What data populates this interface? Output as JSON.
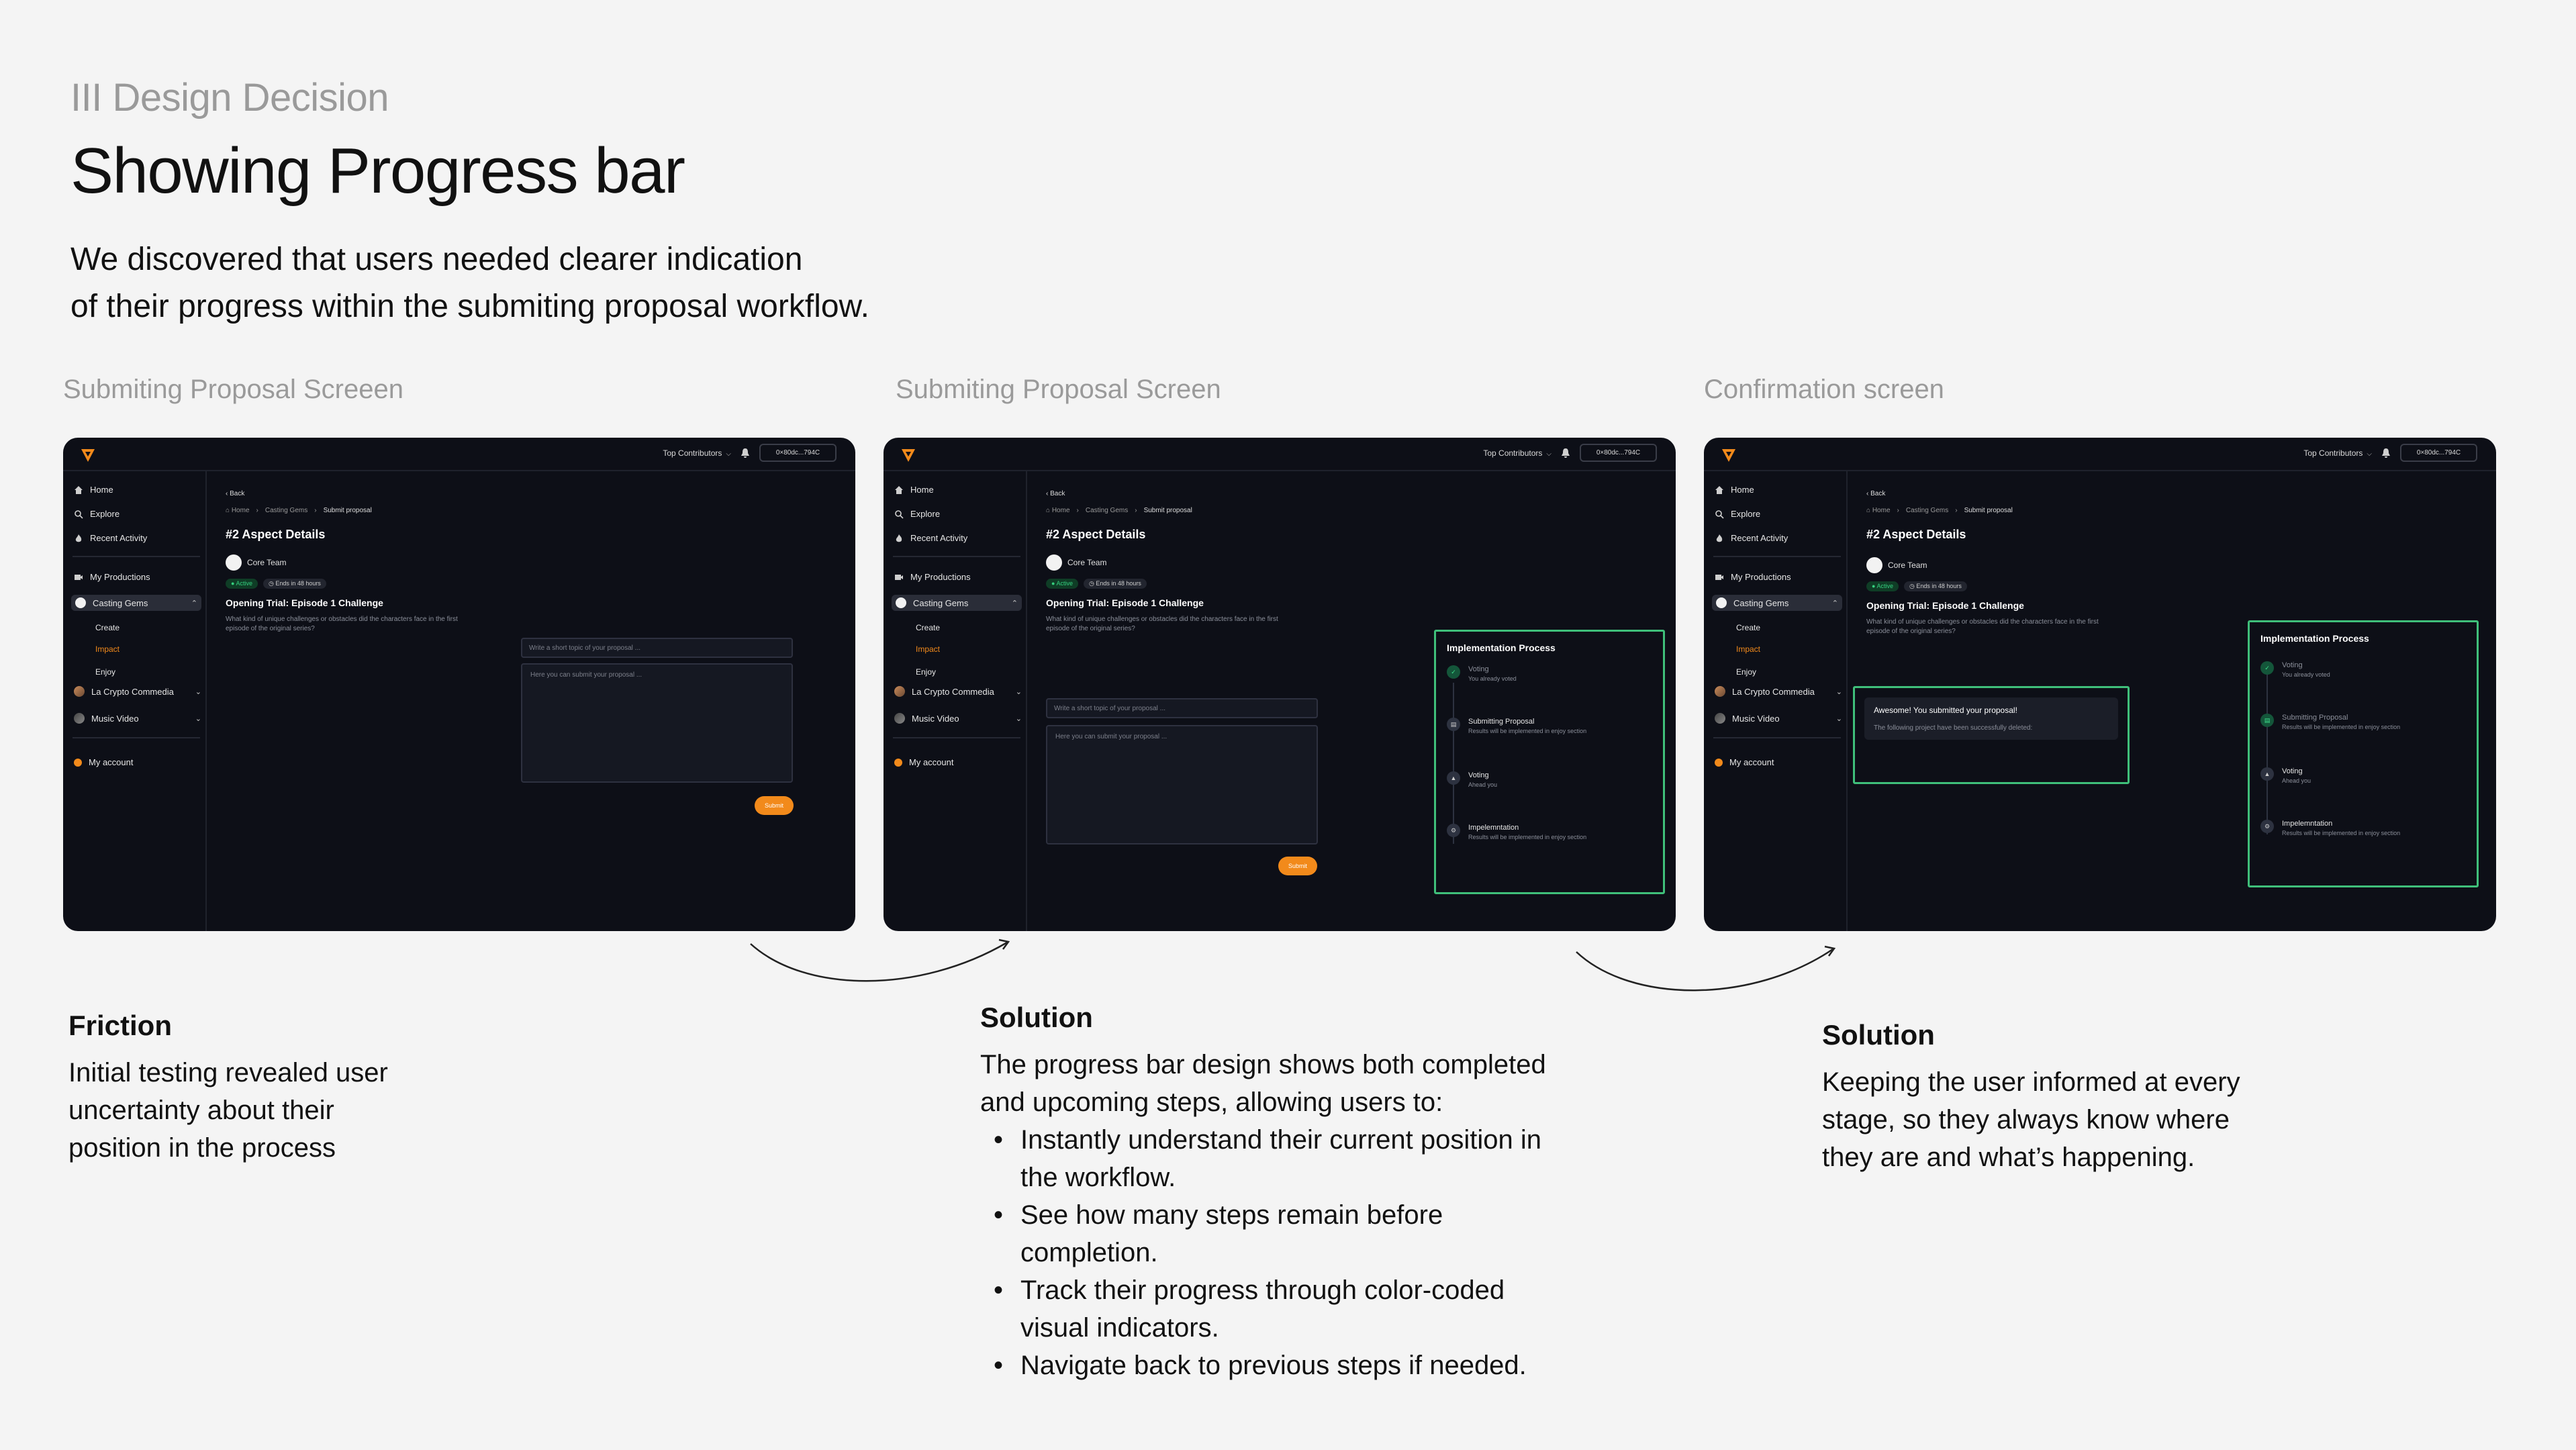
{
  "header": {
    "kicker": "III Design Decision",
    "title": "Showing Progress bar",
    "intro_line1": "We discovered that users needed clearer indication",
    "intro_line2": "of their progress within the submiting proposal workflow."
  },
  "screens": [
    {
      "label": "Submiting Proposal Screeen"
    },
    {
      "label": "Submiting Proposal Screen"
    },
    {
      "label": "Confirmation screen"
    }
  ],
  "app": {
    "top_contributors": "Top Contributors",
    "wallet": "0×80dc...794C",
    "nav": {
      "home": "Home",
      "explore": "Explore",
      "recent_activity": "Recent Activity",
      "my_productions": "My Productions",
      "casting_gems": "Casting Gems",
      "create": "Create",
      "impact": "Impact",
      "enjoy": "Enjoy",
      "la_crypto": "La Crypto Commedia",
      "music_video": "Music Video",
      "my_account": "My account"
    },
    "back": "Back",
    "breadcrumb": [
      "Home",
      "Casting Gems",
      "Submit proposal"
    ],
    "section_title": "#2 Aspect Details",
    "team": "Core Team",
    "badge_active": "Active",
    "badge_ends": "Ends in 48 hours",
    "challenge": "Opening Trial: Episode 1 Challenge",
    "question": "What kind of unique challenges or obstacles did the characters face in the first episode of the original series?",
    "topic_placeholder": "Write a short topic of your proposal ...",
    "body_placeholder": "Here you can submit your proposal ...",
    "submit": "Submit",
    "impl_title": "Implementation Process",
    "steps": [
      {
        "title": "Voting",
        "sub": "You already voted"
      },
      {
        "title": "Submitting Proposal",
        "sub": "Results will be implemented in enjoy section"
      },
      {
        "title": "Voting",
        "sub": "Ahead you"
      },
      {
        "title": "Impelemntation",
        "sub": "Results will be implemented in enjoy section"
      }
    ],
    "toast_title": "Awesome! You submitted your proposal!",
    "toast_sub": "The following project have been successfully deleted:"
  },
  "captions": {
    "friction_title": "Friction",
    "friction_lines": [
      "Initial testing revealed user",
      "uncertainty about their",
      "position in the process"
    ],
    "solution1_title": "Solution",
    "solution1_lines": [
      "The progress bar design shows both completed",
      "and upcoming steps, allowing users to:"
    ],
    "solution1_bullets": [
      [
        "Instantly understand their current position in",
        "the workflow."
      ],
      [
        "See how many steps remain before",
        "completion."
      ],
      [
        "Track their progress through color-coded",
        "visual indicators."
      ],
      [
        "Navigate back to previous steps if needed."
      ]
    ],
    "solution2_title": "Solution",
    "solution2_lines": [
      "Keeping the user informed at every",
      "stage, so they always know where",
      "they are and what’s happening."
    ]
  },
  "colors": {
    "accent": "#f28a1b",
    "success": "#3fbf7a",
    "screen_bg": "#0d0f17",
    "page_bg": "#f4f4f4"
  }
}
